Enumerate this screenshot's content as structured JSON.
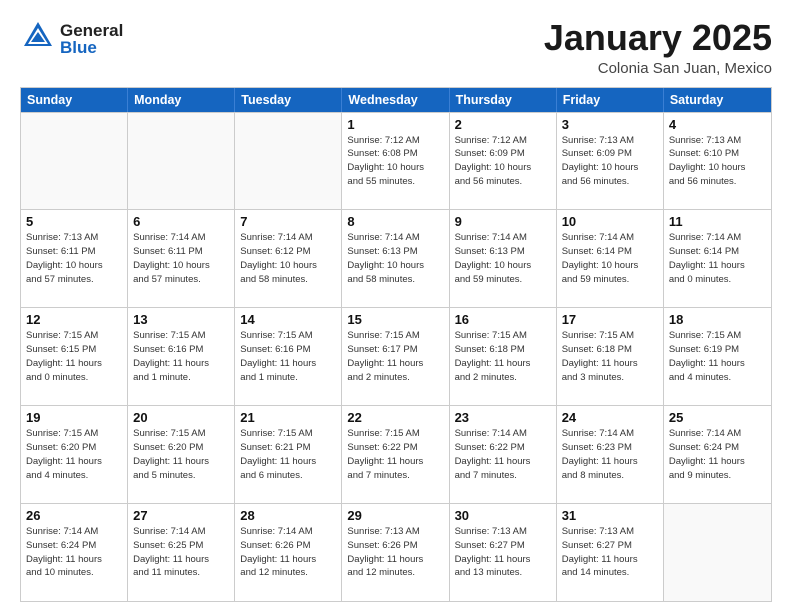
{
  "header": {
    "logo_general": "General",
    "logo_blue": "Blue",
    "title": "January 2025",
    "subtitle": "Colonia San Juan, Mexico"
  },
  "calendar": {
    "days_of_week": [
      "Sunday",
      "Monday",
      "Tuesday",
      "Wednesday",
      "Thursday",
      "Friday",
      "Saturday"
    ],
    "weeks": [
      [
        {
          "day": "",
          "info": ""
        },
        {
          "day": "",
          "info": ""
        },
        {
          "day": "",
          "info": ""
        },
        {
          "day": "1",
          "info": "Sunrise: 7:12 AM\nSunset: 6:08 PM\nDaylight: 10 hours\nand 55 minutes."
        },
        {
          "day": "2",
          "info": "Sunrise: 7:12 AM\nSunset: 6:09 PM\nDaylight: 10 hours\nand 56 minutes."
        },
        {
          "day": "3",
          "info": "Sunrise: 7:13 AM\nSunset: 6:09 PM\nDaylight: 10 hours\nand 56 minutes."
        },
        {
          "day": "4",
          "info": "Sunrise: 7:13 AM\nSunset: 6:10 PM\nDaylight: 10 hours\nand 56 minutes."
        }
      ],
      [
        {
          "day": "5",
          "info": "Sunrise: 7:13 AM\nSunset: 6:11 PM\nDaylight: 10 hours\nand 57 minutes."
        },
        {
          "day": "6",
          "info": "Sunrise: 7:14 AM\nSunset: 6:11 PM\nDaylight: 10 hours\nand 57 minutes."
        },
        {
          "day": "7",
          "info": "Sunrise: 7:14 AM\nSunset: 6:12 PM\nDaylight: 10 hours\nand 58 minutes."
        },
        {
          "day": "8",
          "info": "Sunrise: 7:14 AM\nSunset: 6:13 PM\nDaylight: 10 hours\nand 58 minutes."
        },
        {
          "day": "9",
          "info": "Sunrise: 7:14 AM\nSunset: 6:13 PM\nDaylight: 10 hours\nand 59 minutes."
        },
        {
          "day": "10",
          "info": "Sunrise: 7:14 AM\nSunset: 6:14 PM\nDaylight: 10 hours\nand 59 minutes."
        },
        {
          "day": "11",
          "info": "Sunrise: 7:14 AM\nSunset: 6:14 PM\nDaylight: 11 hours\nand 0 minutes."
        }
      ],
      [
        {
          "day": "12",
          "info": "Sunrise: 7:15 AM\nSunset: 6:15 PM\nDaylight: 11 hours\nand 0 minutes."
        },
        {
          "day": "13",
          "info": "Sunrise: 7:15 AM\nSunset: 6:16 PM\nDaylight: 11 hours\nand 1 minute."
        },
        {
          "day": "14",
          "info": "Sunrise: 7:15 AM\nSunset: 6:16 PM\nDaylight: 11 hours\nand 1 minute."
        },
        {
          "day": "15",
          "info": "Sunrise: 7:15 AM\nSunset: 6:17 PM\nDaylight: 11 hours\nand 2 minutes."
        },
        {
          "day": "16",
          "info": "Sunrise: 7:15 AM\nSunset: 6:18 PM\nDaylight: 11 hours\nand 2 minutes."
        },
        {
          "day": "17",
          "info": "Sunrise: 7:15 AM\nSunset: 6:18 PM\nDaylight: 11 hours\nand 3 minutes."
        },
        {
          "day": "18",
          "info": "Sunrise: 7:15 AM\nSunset: 6:19 PM\nDaylight: 11 hours\nand 4 minutes."
        }
      ],
      [
        {
          "day": "19",
          "info": "Sunrise: 7:15 AM\nSunset: 6:20 PM\nDaylight: 11 hours\nand 4 minutes."
        },
        {
          "day": "20",
          "info": "Sunrise: 7:15 AM\nSunset: 6:20 PM\nDaylight: 11 hours\nand 5 minutes."
        },
        {
          "day": "21",
          "info": "Sunrise: 7:15 AM\nSunset: 6:21 PM\nDaylight: 11 hours\nand 6 minutes."
        },
        {
          "day": "22",
          "info": "Sunrise: 7:15 AM\nSunset: 6:22 PM\nDaylight: 11 hours\nand 7 minutes."
        },
        {
          "day": "23",
          "info": "Sunrise: 7:14 AM\nSunset: 6:22 PM\nDaylight: 11 hours\nand 7 minutes."
        },
        {
          "day": "24",
          "info": "Sunrise: 7:14 AM\nSunset: 6:23 PM\nDaylight: 11 hours\nand 8 minutes."
        },
        {
          "day": "25",
          "info": "Sunrise: 7:14 AM\nSunset: 6:24 PM\nDaylight: 11 hours\nand 9 minutes."
        }
      ],
      [
        {
          "day": "26",
          "info": "Sunrise: 7:14 AM\nSunset: 6:24 PM\nDaylight: 11 hours\nand 10 minutes."
        },
        {
          "day": "27",
          "info": "Sunrise: 7:14 AM\nSunset: 6:25 PM\nDaylight: 11 hours\nand 11 minutes."
        },
        {
          "day": "28",
          "info": "Sunrise: 7:14 AM\nSunset: 6:26 PM\nDaylight: 11 hours\nand 12 minutes."
        },
        {
          "day": "29",
          "info": "Sunrise: 7:13 AM\nSunset: 6:26 PM\nDaylight: 11 hours\nand 12 minutes."
        },
        {
          "day": "30",
          "info": "Sunrise: 7:13 AM\nSunset: 6:27 PM\nDaylight: 11 hours\nand 13 minutes."
        },
        {
          "day": "31",
          "info": "Sunrise: 7:13 AM\nSunset: 6:27 PM\nDaylight: 11 hours\nand 14 minutes."
        },
        {
          "day": "",
          "info": ""
        }
      ]
    ]
  }
}
